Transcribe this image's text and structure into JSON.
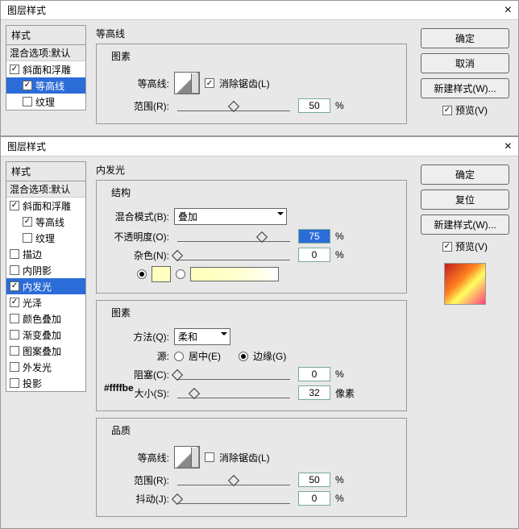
{
  "dialog1": {
    "title": "图层样式",
    "sidebar_title": "样式",
    "blend_defaults": "混合选项:默认",
    "items": [
      {
        "label": "斜面和浮雕",
        "checked": true,
        "indent": false,
        "selected": false
      },
      {
        "label": "等高线",
        "checked": true,
        "indent": true,
        "selected": true
      },
      {
        "label": "纹理",
        "checked": false,
        "indent": true,
        "selected": false
      }
    ],
    "section": "等高线",
    "group_elements": "图素",
    "contour_label": "等高线:",
    "anti_alias": "消除锯齿(L)",
    "range_label": "范围(R):",
    "range_value": "50",
    "pct": "%",
    "buttons": {
      "ok": "确定",
      "cancel": "取消",
      "newstyle": "新建样式(W)...",
      "preview": "预览(V)"
    }
  },
  "dialog2": {
    "title": "图层样式",
    "sidebar_title": "样式",
    "blend_defaults": "混合选项:默认",
    "items": [
      {
        "label": "斜面和浮雕",
        "checked": true
      },
      {
        "label": "等高线",
        "checked": true,
        "indent": true
      },
      {
        "label": "纹理",
        "checked": false,
        "indent": true
      },
      {
        "label": "描边",
        "checked": false
      },
      {
        "label": "内阴影",
        "checked": false
      },
      {
        "label": "内发光",
        "checked": true,
        "selected": true
      },
      {
        "label": "光泽",
        "checked": true
      },
      {
        "label": "颜色叠加",
        "checked": false
      },
      {
        "label": "渐变叠加",
        "checked": false
      },
      {
        "label": "图案叠加",
        "checked": false
      },
      {
        "label": "外发光",
        "checked": false
      },
      {
        "label": "投影",
        "checked": false
      }
    ],
    "section": "内发光",
    "group_struct": "结构",
    "blend_mode_label": "混合模式(B):",
    "blend_mode_value": "叠加",
    "opacity_label": "不透明度(O):",
    "opacity_value": "75",
    "noise_label": "杂色(N):",
    "noise_value": "0",
    "color_hex": "#ffffbe",
    "group_elements": "图素",
    "method_label": "方法(Q):",
    "method_value": "柔和",
    "source_label": "源:",
    "source_center": "居中(E)",
    "source_edge": "边缘(G)",
    "choke_label": "阻塞(C):",
    "choke_value": "0",
    "size_label": "大小(S):",
    "size_value": "32",
    "size_unit": "像素",
    "group_quality": "品质",
    "contour_label": "等高线:",
    "anti_alias": "消除锯齿(L)",
    "range_label": "范围(R):",
    "range_value": "50",
    "jitter_label": "抖动(J):",
    "jitter_value": "0",
    "pct": "%",
    "buttons": {
      "ok": "确定",
      "reset": "复位",
      "newstyle": "新建样式(W)...",
      "preview": "预览(V)"
    }
  }
}
